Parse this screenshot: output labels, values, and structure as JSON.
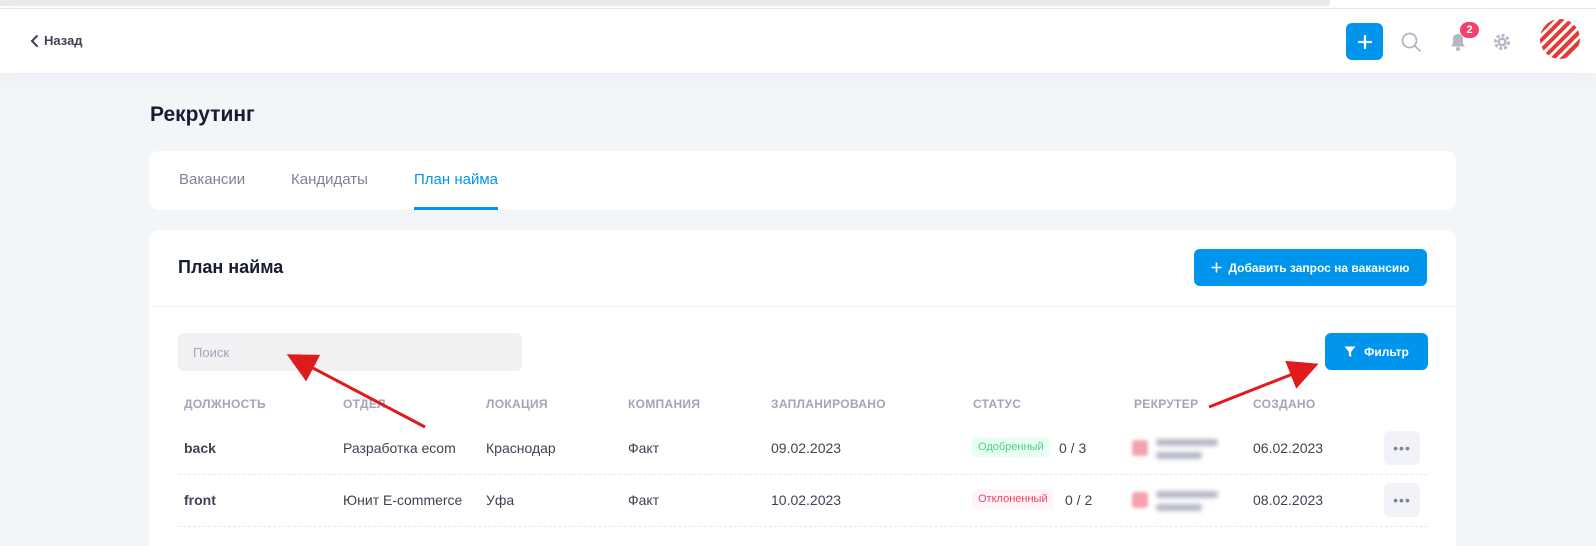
{
  "header": {
    "back_label": "Назад",
    "notifications_count": "2"
  },
  "page": {
    "title": "Рекрутинг"
  },
  "tabs": [
    {
      "label": "Вакансии",
      "active": false
    },
    {
      "label": "Кандидаты",
      "active": false
    },
    {
      "label": "План найма",
      "active": true
    }
  ],
  "card": {
    "title": "План найма",
    "add_button_label": "Добавить запрос на вакансию",
    "search_placeholder": "Поиск",
    "filter_button_label": "Фильтр"
  },
  "table": {
    "columns": [
      "ДОЛЖНОСТЬ",
      "ОТДЕЛ",
      "ЛОКАЦИЯ",
      "КОМПАНИЯ",
      "ЗАПЛАНИРОВАНО",
      "СТАТУС",
      "РЕКРУТЕР",
      "СОЗДАНО"
    ],
    "rows": [
      {
        "position": "back",
        "department": "Разработка ecom",
        "location": "Краснодар",
        "company": "Факт",
        "planned": "09.02.2023",
        "status": "Одобренный",
        "status_type": "approved",
        "count": "0 / 3",
        "created": "06.02.2023"
      },
      {
        "position": "front",
        "department": "Юнит E-commerce",
        "location": "Уфа",
        "company": "Факт",
        "planned": "10.02.2023",
        "status": "Отклоненный",
        "status_type": "rejected",
        "count": "0 / 2",
        "created": "08.02.2023"
      }
    ]
  },
  "colors": {
    "accent": "#0095ec",
    "badge": "#f1416c",
    "annotation_arrow": "#e01b1b"
  }
}
